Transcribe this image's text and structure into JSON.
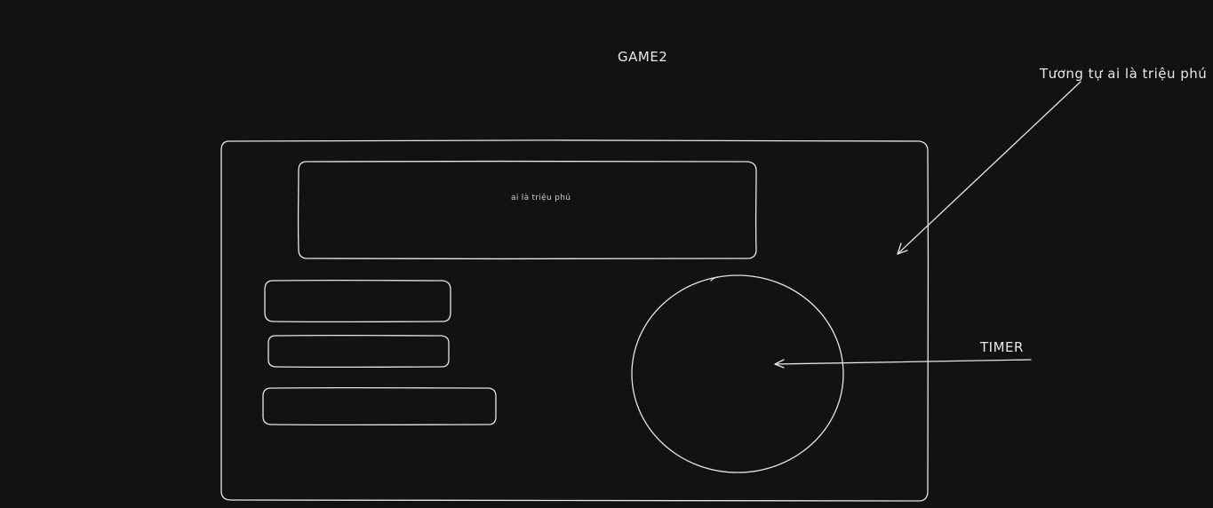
{
  "diagram": {
    "title": "GAME2",
    "question_box_text": "ai là triệu phú",
    "annotation_note": "Tương tự ai là triệu phú",
    "annotation_timer": "TIMER",
    "colors": {
      "background": "#121212",
      "stroke": "#e6e6e6"
    }
  }
}
